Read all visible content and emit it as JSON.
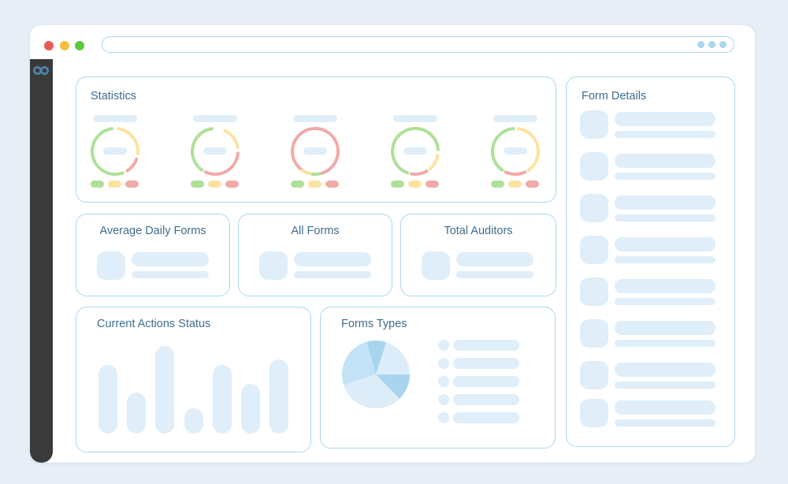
{
  "window": {
    "controls": [
      "close",
      "minimize",
      "maximize"
    ],
    "colors": {
      "close": "#ec5a55",
      "minimize": "#f6be3a",
      "maximize": "#5dc93d"
    },
    "url_placeholder": "",
    "sidebar_logo": "infinity-logo-icon"
  },
  "colors": {
    "accent_border": "#a9d6ee",
    "placeholder": "#dfeef8",
    "title_text": "#3f6d8f",
    "gauge_green": "#aee198",
    "gauge_yellow": "#fbe39f",
    "gauge_red": "#f2aaa7",
    "sidebar": "#3a3a3a"
  },
  "statistics": {
    "title": "Statistics",
    "gauges": [
      {
        "segments": [
          {
            "color": "green",
            "from": 160,
            "to": 352
          },
          {
            "color": "yellow",
            "from": 8,
            "to": 95
          },
          {
            "color": "red",
            "from": 110,
            "to": 148
          }
        ]
      },
      {
        "segments": [
          {
            "color": "green",
            "from": 215,
            "to": 352
          },
          {
            "color": "yellow",
            "from": 25,
            "to": 80
          },
          {
            "color": "red",
            "from": 95,
            "to": 205
          }
        ]
      },
      {
        "segments": [
          {
            "color": "red",
            "from": 200,
            "to": 165
          },
          {
            "color": "green",
            "from": 170,
            "to": 188
          },
          {
            "color": "yellow",
            "from": 193,
            "to": 215
          }
        ]
      },
      {
        "segments": [
          {
            "color": "green",
            "from": 200,
            "to": 85
          },
          {
            "color": "yellow",
            "from": 100,
            "to": 140
          },
          {
            "color": "red",
            "from": 150,
            "to": 190
          }
        ]
      },
      {
        "segments": [
          {
            "color": "green",
            "from": 215,
            "to": 355
          },
          {
            "color": "yellow",
            "from": 8,
            "to": 145
          },
          {
            "color": "red",
            "from": 155,
            "to": 205
          }
        ]
      }
    ]
  },
  "summary_cards": [
    {
      "title": "Average Daily Forms"
    },
    {
      "title": "All Forms"
    },
    {
      "title": "Total Auditors"
    }
  ],
  "actions_status": {
    "title": "Current Actions Status",
    "bar_levels": [
      0.78,
      0.47,
      1.0,
      0.29,
      0.78,
      0.57,
      0.85
    ]
  },
  "forms_types": {
    "title": "Forms Types",
    "pie_slices": [
      {
        "from": -16,
        "to": 18,
        "color": "#a8d4ef"
      },
      {
        "from": 18,
        "to": 90,
        "color": "#dcedf9"
      },
      {
        "from": 90,
        "to": 136,
        "color": "#a8d4ef"
      },
      {
        "from": 136,
        "to": 252,
        "color": "#dcedf9"
      },
      {
        "from": 252,
        "to": 344,
        "color": "#c3e2f5"
      }
    ],
    "legend_count": 5
  },
  "form_details": {
    "title": "Form Details",
    "item_count": 8
  }
}
